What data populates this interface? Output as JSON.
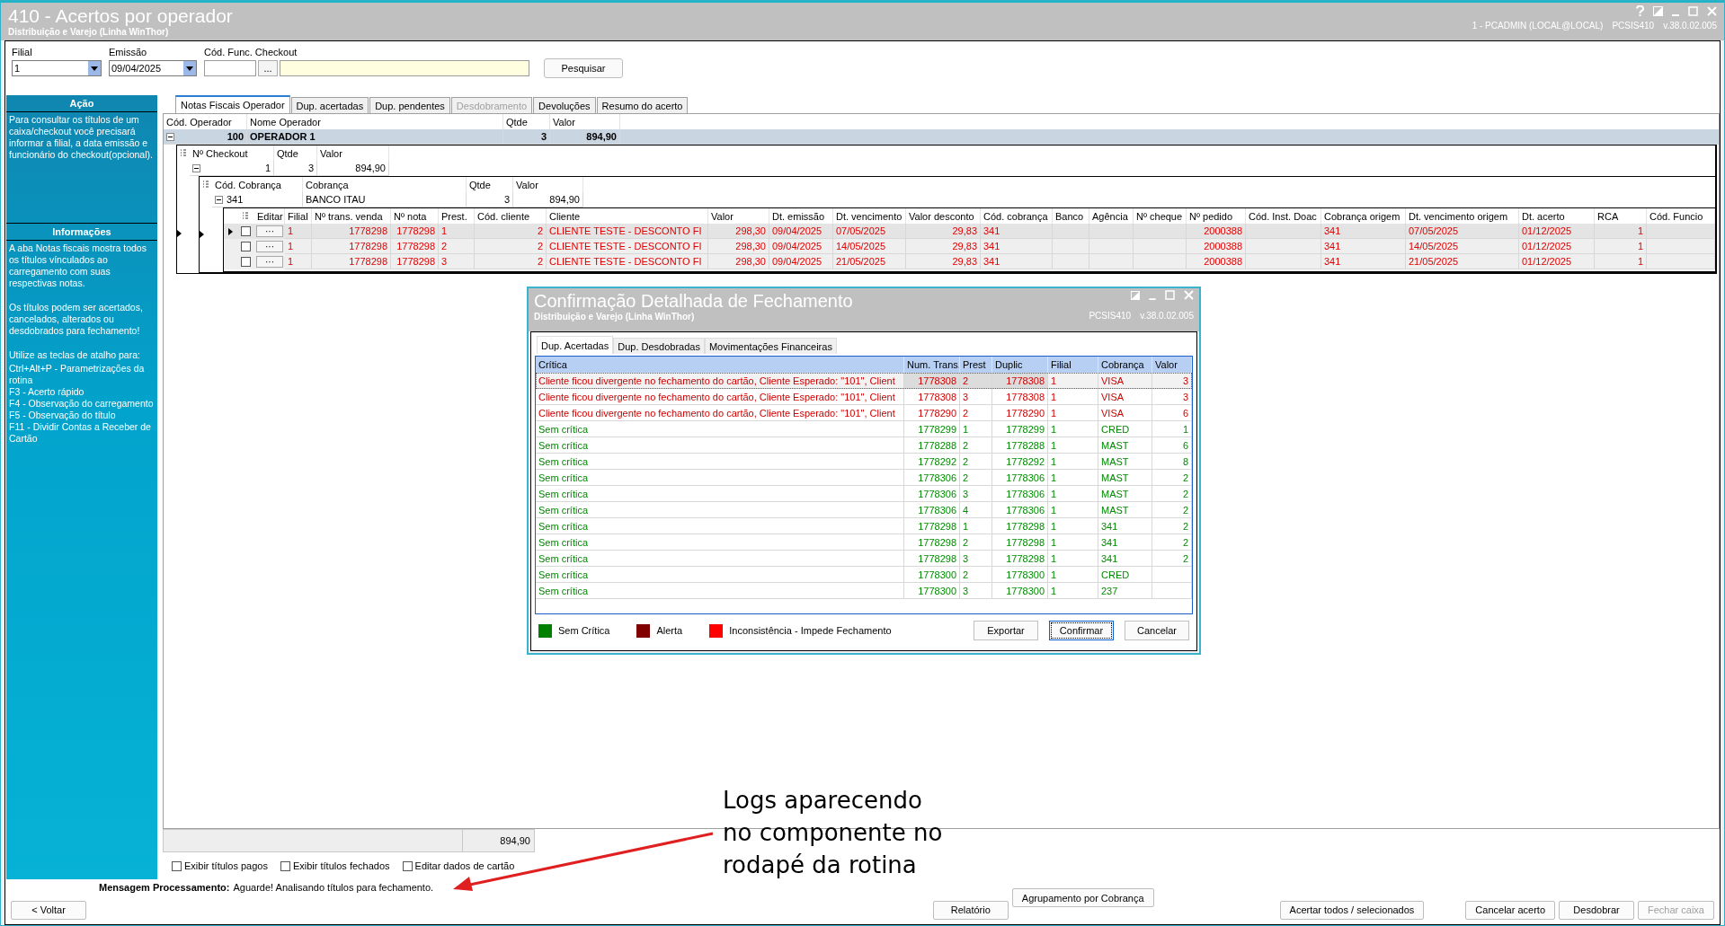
{
  "window": {
    "title": "410 - Acertos por operador",
    "subtitle": "Distribuição e Varejo (Linha WinThor)",
    "session": "1 - PCADMIN (LOCAL@LOCAL)",
    "program": "PCSIS410",
    "version": "v.38.0.02.005"
  },
  "filters": {
    "filial": {
      "label": "Filial",
      "value": "1"
    },
    "emissao": {
      "label": "Emissão",
      "value": "09/04/2025"
    },
    "checkout": {
      "label": "Cód. Func. Checkout",
      "lookup": "...",
      "search": "Pesquisar"
    }
  },
  "sidebar": {
    "action": {
      "title": "Ação",
      "text": "Para consultar os títulos de um caixa/checkout você precisará informar a filial, a data emissão e funcionário do checkout(opcional)."
    },
    "info": {
      "title": "Informações",
      "paragraphs": [
        "A aba Notas fiscais mostra todos os títulos vínculados ao carregamento com suas respectivas notas.",
        "Os títulos podem ser acertados, cancelados, alterados ou desdobrados para fechamento!"
      ],
      "shortcut_intro": "Utilize as teclas de atalho para:",
      "shortcuts": [
        "Ctrl+Alt+P - Parametrizações da rotina",
        "F3 - Acerto rápido",
        "F4 - Observação do carregamento",
        "F5 - Observação do título",
        "F11 - Dividir Contas a Receber de Cartão"
      ]
    }
  },
  "tabs": [
    {
      "label": "Notas Fiscais Operador",
      "selected": true,
      "disabled": false
    },
    {
      "label": "Dup. acertadas",
      "selected": false,
      "disabled": false
    },
    {
      "label": "Dup. pendentes",
      "selected": false,
      "disabled": false
    },
    {
      "label": "Desdobramento",
      "selected": false,
      "disabled": true
    },
    {
      "label": "Devoluções",
      "selected": false,
      "disabled": false
    },
    {
      "label": "Resumo do acerto",
      "selected": false,
      "disabled": false
    }
  ],
  "operators": {
    "columns": [
      "Cód. Operador",
      "Nome Operador",
      "Qtde",
      "Valor"
    ],
    "rows": [
      {
        "expanded": true,
        "cells": [
          "100",
          "OPERADOR 1",
          "3",
          "894,90"
        ]
      }
    ]
  },
  "checkouts": {
    "columns": [
      "Nº Checkout",
      "Qtde",
      "Valor"
    ],
    "rows": [
      {
        "expanded": true,
        "cells": [
          "1",
          "3",
          "894,90"
        ]
      }
    ]
  },
  "billings": {
    "columns": [
      "Cód. Cobrança",
      "Cobrança",
      "Qtde",
      "Valor"
    ],
    "rows": [
      {
        "expanded": true,
        "cells": [
          "341",
          "BANCO ITAU",
          "3",
          "894,90"
        ]
      }
    ]
  },
  "titles": {
    "columns": [
      "Editar",
      "Filial",
      "Nº trans. venda",
      "Nº nota",
      "Prest.",
      "Cód. cliente",
      "Cliente",
      "Valor",
      "Dt. emissão",
      "Dt. vencimento",
      "Valor desconto",
      "Cód. cobrança",
      "Banco",
      "Agência",
      "Nº cheque",
      "Nº pedido",
      "Cód. Inst. Doac",
      "Cobrança origem",
      "Dt. vencimento origem",
      "Dt. acerto",
      "RCA",
      "Cód. Funcio"
    ],
    "rows": [
      {
        "selected": true,
        "checked": false,
        "cells": [
          "···",
          "1",
          "1778298",
          "1778298",
          "1",
          "2",
          "CLIENTE TESTE - DESCONTO FI",
          "298,30",
          "09/04/2025",
          "07/05/2025",
          "29,83",
          "341",
          null,
          null,
          null,
          "2000388",
          null,
          "341",
          "07/05/2025",
          "01/12/2025",
          "1",
          null
        ]
      },
      {
        "selected": false,
        "checked": false,
        "cells": [
          "···",
          "1",
          "1778298",
          "1778298",
          "2",
          "2",
          "CLIENTE TESTE - DESCONTO FI",
          "298,30",
          "09/04/2025",
          "14/05/2025",
          "29,83",
          "341",
          null,
          null,
          null,
          "2000388",
          null,
          "341",
          "14/05/2025",
          "01/12/2025",
          "1",
          null
        ]
      },
      {
        "selected": false,
        "checked": false,
        "cells": [
          "···",
          "1",
          "1778298",
          "1778298",
          "3",
          "2",
          "CLIENTE TESTE - DESCONTO FI",
          "298,30",
          "09/04/2025",
          "21/05/2025",
          "29,83",
          "341",
          null,
          null,
          null,
          "2000388",
          null,
          "341",
          "21/05/2025",
          "01/12/2025",
          "1",
          null
        ]
      }
    ]
  },
  "total": "894,90",
  "options": [
    {
      "label": "Exibir títulos pagos",
      "checked": false
    },
    {
      "label": "Exibir títulos fechados",
      "checked": false
    },
    {
      "label": "Editar dados de cartão",
      "checked": false
    }
  ],
  "status": {
    "label": "Mensagem Processamento:",
    "text": "Aguarde! Analisando títulos para fechamento."
  },
  "back_button": "< Voltar",
  "buttons": [
    {
      "label": "Relatório",
      "disabled": false,
      "raised": false
    },
    {
      "label": "Agrupamento por Cobrança",
      "disabled": false,
      "raised": true
    },
    {
      "label": "Acertar todos / selecionados",
      "disabled": false,
      "raised": false
    },
    {
      "label": "Cancelar acerto",
      "disabled": false,
      "raised": false
    },
    {
      "label": "Desdobrar",
      "disabled": false,
      "raised": false
    },
    {
      "label": "Fechar caixa",
      "disabled": true,
      "raised": false
    }
  ],
  "dialog": {
    "title": "Confirmação Detalhada de Fechamento",
    "subtitle": "Distribuição e Varejo (Linha WinThor)",
    "program": "PCSIS410",
    "version": "v.38.0.02.005",
    "tabs": [
      {
        "label": "Dup. Acertadas",
        "selected": true
      },
      {
        "label": "Dup. Desdobradas",
        "selected": false
      },
      {
        "label": "Movimentações Financeiras",
        "selected": false
      }
    ],
    "columns": [
      "Crítica",
      "Num. Trans.",
      "Prest",
      "Duplic",
      "Filial",
      "Cobrança",
      "Valor"
    ],
    "rows": [
      {
        "kind": "error",
        "selected": true,
        "cells": [
          "Cliente ficou divergente no fechamento do cartão, Cliente Esperado: \"101\", Client",
          "1778308",
          "2",
          "1778308",
          "1",
          "VISA",
          "3"
        ]
      },
      {
        "kind": "error",
        "selected": false,
        "cells": [
          "Cliente ficou divergente no fechamento do cartão, Cliente Esperado: \"101\", Client",
          "1778308",
          "3",
          "1778308",
          "1",
          "VISA",
          "3"
        ]
      },
      {
        "kind": "error",
        "selected": false,
        "cells": [
          "Cliente ficou divergente no fechamento do cartão, Cliente Esperado: \"101\", Client",
          "1778290",
          "2",
          "1778290",
          "1",
          "VISA",
          "6"
        ]
      },
      {
        "kind": "ok",
        "selected": false,
        "cells": [
          "Sem crítica",
          "1778299",
          "1",
          "1778299",
          "1",
          "CRED",
          "1"
        ]
      },
      {
        "kind": "ok",
        "selected": false,
        "cells": [
          "Sem crítica",
          "1778288",
          "2",
          "1778288",
          "1",
          "MAST",
          "6"
        ]
      },
      {
        "kind": "ok",
        "selected": false,
        "cells": [
          "Sem crítica",
          "1778292",
          "2",
          "1778292",
          "1",
          "MAST",
          "8"
        ]
      },
      {
        "kind": "ok",
        "selected": false,
        "cells": [
          "Sem crítica",
          "1778306",
          "2",
          "1778306",
          "1",
          "MAST",
          "2"
        ]
      },
      {
        "kind": "ok",
        "selected": false,
        "cells": [
          "Sem crítica",
          "1778306",
          "3",
          "1778306",
          "1",
          "MAST",
          "2"
        ]
      },
      {
        "kind": "ok",
        "selected": false,
        "cells": [
          "Sem crítica",
          "1778306",
          "4",
          "1778306",
          "1",
          "MAST",
          "2"
        ]
      },
      {
        "kind": "ok",
        "selected": false,
        "cells": [
          "Sem crítica",
          "1778298",
          "1",
          "1778298",
          "1",
          "341",
          "2"
        ]
      },
      {
        "kind": "ok",
        "selected": false,
        "cells": [
          "Sem crítica",
          "1778298",
          "2",
          "1778298",
          "1",
          "341",
          "2"
        ]
      },
      {
        "kind": "ok",
        "selected": false,
        "cells": [
          "Sem crítica",
          "1778298",
          "3",
          "1778298",
          "1",
          "341",
          "2"
        ]
      },
      {
        "kind": "ok",
        "selected": false,
        "cells": [
          "Sem crítica",
          "1778300",
          "2",
          "1778300",
          "1",
          "CRED",
          null
        ]
      },
      {
        "kind": "ok",
        "selected": false,
        "cells": [
          "Sem crítica",
          "1778300",
          "3",
          "1778300",
          "1",
          "237",
          null
        ]
      }
    ],
    "legend": [
      {
        "label": "Sem Crítica",
        "color": "#008000"
      },
      {
        "label": "Alerta",
        "color": "#800000"
      },
      {
        "label": "Inconsistência - Impede Fechamento",
        "color": "#ff0000"
      }
    ],
    "buttons": [
      {
        "label": "Exportar",
        "focused": false
      },
      {
        "label": "Confirmar",
        "focused": true
      },
      {
        "label": "Cancelar",
        "focused": false
      }
    ]
  },
  "annotation": "Logs aparecendo no componente no rodapé da rotina"
}
